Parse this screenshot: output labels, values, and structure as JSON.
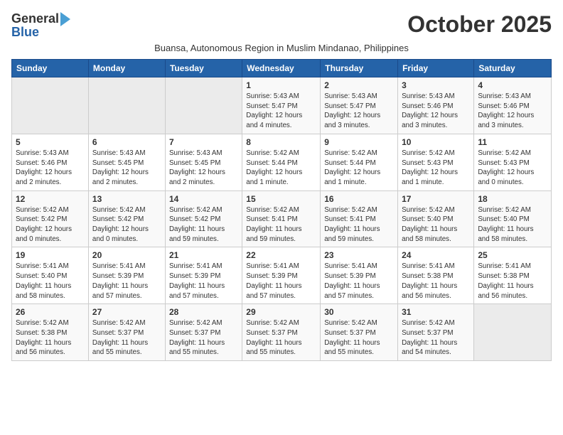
{
  "header": {
    "logo_line1": "General",
    "logo_line2": "Blue",
    "month_title": "October 2025",
    "subtitle": "Buansa, Autonomous Region in Muslim Mindanao, Philippines"
  },
  "days_of_week": [
    "Sunday",
    "Monday",
    "Tuesday",
    "Wednesday",
    "Thursday",
    "Friday",
    "Saturday"
  ],
  "weeks": [
    [
      {
        "num": "",
        "info": ""
      },
      {
        "num": "",
        "info": ""
      },
      {
        "num": "",
        "info": ""
      },
      {
        "num": "1",
        "info": "Sunrise: 5:43 AM\nSunset: 5:47 PM\nDaylight: 12 hours\nand 4 minutes."
      },
      {
        "num": "2",
        "info": "Sunrise: 5:43 AM\nSunset: 5:47 PM\nDaylight: 12 hours\nand 3 minutes."
      },
      {
        "num": "3",
        "info": "Sunrise: 5:43 AM\nSunset: 5:46 PM\nDaylight: 12 hours\nand 3 minutes."
      },
      {
        "num": "4",
        "info": "Sunrise: 5:43 AM\nSunset: 5:46 PM\nDaylight: 12 hours\nand 3 minutes."
      }
    ],
    [
      {
        "num": "5",
        "info": "Sunrise: 5:43 AM\nSunset: 5:46 PM\nDaylight: 12 hours\nand 2 minutes."
      },
      {
        "num": "6",
        "info": "Sunrise: 5:43 AM\nSunset: 5:45 PM\nDaylight: 12 hours\nand 2 minutes."
      },
      {
        "num": "7",
        "info": "Sunrise: 5:43 AM\nSunset: 5:45 PM\nDaylight: 12 hours\nand 2 minutes."
      },
      {
        "num": "8",
        "info": "Sunrise: 5:42 AM\nSunset: 5:44 PM\nDaylight: 12 hours\nand 1 minute."
      },
      {
        "num": "9",
        "info": "Sunrise: 5:42 AM\nSunset: 5:44 PM\nDaylight: 12 hours\nand 1 minute."
      },
      {
        "num": "10",
        "info": "Sunrise: 5:42 AM\nSunset: 5:43 PM\nDaylight: 12 hours\nand 1 minute."
      },
      {
        "num": "11",
        "info": "Sunrise: 5:42 AM\nSunset: 5:43 PM\nDaylight: 12 hours\nand 0 minutes."
      }
    ],
    [
      {
        "num": "12",
        "info": "Sunrise: 5:42 AM\nSunset: 5:42 PM\nDaylight: 12 hours\nand 0 minutes."
      },
      {
        "num": "13",
        "info": "Sunrise: 5:42 AM\nSunset: 5:42 PM\nDaylight: 12 hours\nand 0 minutes."
      },
      {
        "num": "14",
        "info": "Sunrise: 5:42 AM\nSunset: 5:42 PM\nDaylight: 11 hours\nand 59 minutes."
      },
      {
        "num": "15",
        "info": "Sunrise: 5:42 AM\nSunset: 5:41 PM\nDaylight: 11 hours\nand 59 minutes."
      },
      {
        "num": "16",
        "info": "Sunrise: 5:42 AM\nSunset: 5:41 PM\nDaylight: 11 hours\nand 59 minutes."
      },
      {
        "num": "17",
        "info": "Sunrise: 5:42 AM\nSunset: 5:40 PM\nDaylight: 11 hours\nand 58 minutes."
      },
      {
        "num": "18",
        "info": "Sunrise: 5:42 AM\nSunset: 5:40 PM\nDaylight: 11 hours\nand 58 minutes."
      }
    ],
    [
      {
        "num": "19",
        "info": "Sunrise: 5:41 AM\nSunset: 5:40 PM\nDaylight: 11 hours\nand 58 minutes."
      },
      {
        "num": "20",
        "info": "Sunrise: 5:41 AM\nSunset: 5:39 PM\nDaylight: 11 hours\nand 57 minutes."
      },
      {
        "num": "21",
        "info": "Sunrise: 5:41 AM\nSunset: 5:39 PM\nDaylight: 11 hours\nand 57 minutes."
      },
      {
        "num": "22",
        "info": "Sunrise: 5:41 AM\nSunset: 5:39 PM\nDaylight: 11 hours\nand 57 minutes."
      },
      {
        "num": "23",
        "info": "Sunrise: 5:41 AM\nSunset: 5:39 PM\nDaylight: 11 hours\nand 57 minutes."
      },
      {
        "num": "24",
        "info": "Sunrise: 5:41 AM\nSunset: 5:38 PM\nDaylight: 11 hours\nand 56 minutes."
      },
      {
        "num": "25",
        "info": "Sunrise: 5:41 AM\nSunset: 5:38 PM\nDaylight: 11 hours\nand 56 minutes."
      }
    ],
    [
      {
        "num": "26",
        "info": "Sunrise: 5:42 AM\nSunset: 5:38 PM\nDaylight: 11 hours\nand 56 minutes."
      },
      {
        "num": "27",
        "info": "Sunrise: 5:42 AM\nSunset: 5:37 PM\nDaylight: 11 hours\nand 55 minutes."
      },
      {
        "num": "28",
        "info": "Sunrise: 5:42 AM\nSunset: 5:37 PM\nDaylight: 11 hours\nand 55 minutes."
      },
      {
        "num": "29",
        "info": "Sunrise: 5:42 AM\nSunset: 5:37 PM\nDaylight: 11 hours\nand 55 minutes."
      },
      {
        "num": "30",
        "info": "Sunrise: 5:42 AM\nSunset: 5:37 PM\nDaylight: 11 hours\nand 55 minutes."
      },
      {
        "num": "31",
        "info": "Sunrise: 5:42 AM\nSunset: 5:37 PM\nDaylight: 11 hours\nand 54 minutes."
      },
      {
        "num": "",
        "info": ""
      }
    ]
  ]
}
